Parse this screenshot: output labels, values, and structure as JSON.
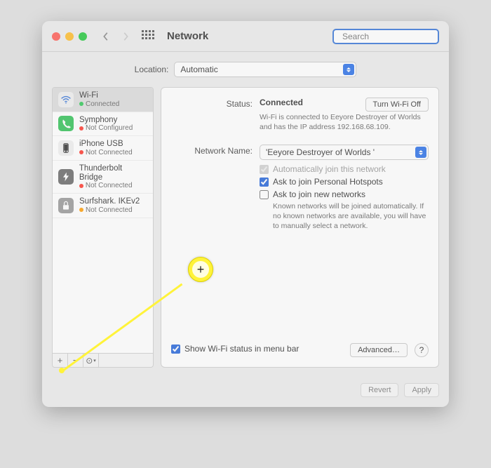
{
  "colors": {
    "accent": "#2e72e8",
    "status_green": "#34c759",
    "status_red": "#ff3b30",
    "status_amber": "#ff9f0a",
    "annotation_yellow": "#fff33a"
  },
  "toolbar": {
    "title": "Network",
    "search_placeholder": "Search"
  },
  "location": {
    "label": "Location:",
    "value": "Automatic"
  },
  "sidebar": {
    "items": [
      {
        "name": "Wi-Fi",
        "status": "Connected",
        "dot": "#34c759",
        "icon": "wifi"
      },
      {
        "name": "Symphony",
        "status": "Not Configured",
        "dot": "#ff3b30",
        "icon": "phone"
      },
      {
        "name": "iPhone USB",
        "status": "Not Connected",
        "dot": "#ff3b30",
        "icon": "usb"
      },
      {
        "name": "Thunderbolt Bridge",
        "status": "Not Connected",
        "dot": "#ff3b30",
        "icon": "tb"
      },
      {
        "name": "Surfshark. IKEv2",
        "status": "Not Connected",
        "dot": "#ff9f0a",
        "icon": "lock"
      }
    ],
    "tools": {
      "add": "+",
      "remove": "−",
      "gear": "⚙"
    }
  },
  "details": {
    "status_label": "Status:",
    "status_value": "Connected",
    "wifi_toggle_label": "Turn Wi-Fi Off",
    "status_sub": "Wi-Fi is connected to Eeyore Destroyer of Worlds  and has the IP address 192.168.68.109.",
    "network_name_label": "Network Name:",
    "network_name_value": "'Eeyore Destroyer of Worlds '",
    "auto_join_label": "Automatically join this network",
    "ask_personal_label": "Ask to join Personal Hotspots",
    "ask_new_label": "Ask to join new networks",
    "ask_new_sub": "Known networks will be joined automatically. If no known networks are available, you will have to manually select a network.",
    "show_status_menubar": "Show Wi-Fi status in menu bar",
    "advanced_label": "Advanced…",
    "help_label": "?"
  },
  "footer": {
    "revert": "Revert",
    "apply": "Apply"
  },
  "annotation": {
    "symbol": "+"
  }
}
